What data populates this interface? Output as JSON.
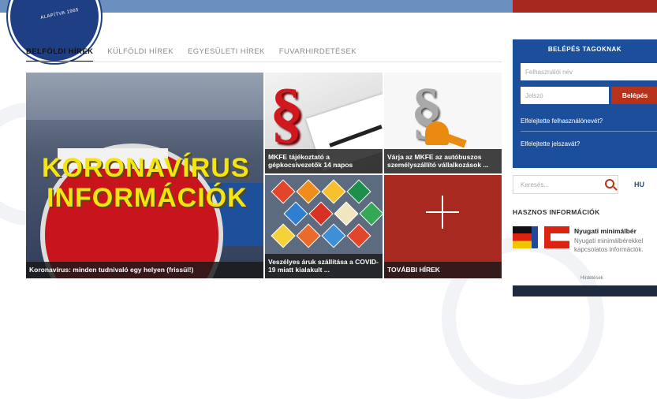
{
  "logo": {
    "text": "ALAPÍTVA 1965"
  },
  "tabs": [
    {
      "label": "BELFÖLDI HÍREK"
    },
    {
      "label": "KÜLFÖLDI HÍREK"
    },
    {
      "label": "EGYESÜLETI HÍREK"
    },
    {
      "label": "FUVARHIRDETÉSEK"
    }
  ],
  "news": {
    "main": {
      "banner_line1": "KORONAVÍRUS",
      "banner_line2": "INFORMÁCIÓK",
      "caption": "Koronavírus: minden tudnivaló egy helyen (frissül!)"
    },
    "card1": {
      "caption": "MKFE tájékoztató a gépkocsivezetők 14 napos"
    },
    "card2": {
      "caption": "Várja az MKFE az autóbuszos személyszállító vállalkozások ..."
    },
    "card3": {
      "caption": "Veszélyes áruk szállítása a COVID-19 miatt kialakult ..."
    },
    "card4": {
      "caption": "TOVÁBBI HÍREK"
    }
  },
  "login": {
    "title": "BELÉPÉS TAGOKNAK",
    "username_placeholder": "Felhasználói név",
    "password_placeholder": "Jelszó",
    "button": "Belépés",
    "forgot_username": "Elfelejtette felhasználónevét?",
    "forgot_password": "Elfelejtette jelszavát?"
  },
  "search": {
    "placeholder": "Keresés..."
  },
  "language": "HU",
  "useful": {
    "title": "HASZNOS INFORMÁCIÓK",
    "item_title": "Nyugati minimálbér",
    "item_desc": "Nyugati minimálbérekkel kapcsolatos információk."
  },
  "footer_label": "Hirdetések",
  "colors": {
    "brand_blue": "#1b4f9c",
    "brand_red": "#a7281e"
  }
}
